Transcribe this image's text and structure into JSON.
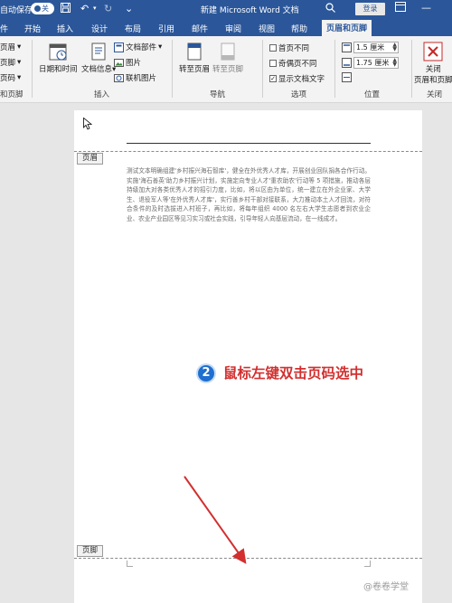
{
  "titlebar": {
    "autosave_label": "自动保存",
    "autosave_state": "关",
    "doc_title": "新建 Microsoft Word 文档",
    "login_label": "登录"
  },
  "tabs": [
    "件",
    "开始",
    "插入",
    "设计",
    "布局",
    "引用",
    "邮件",
    "审阅",
    "视图",
    "帮助",
    "页眉和页脚"
  ],
  "active_tab": "页眉和页脚",
  "ribbon": {
    "left_items": [
      "页眉",
      "页脚",
      "页码"
    ],
    "left_group": "和页脚",
    "date_time": "日期和时间",
    "doc_info": "文档信息",
    "doc_parts": "文档部件",
    "picture": "图片",
    "online_picture": "联机图片",
    "insert_group": "插入",
    "goto_header": "转至页眉",
    "goto_footer": "转至页脚",
    "nav_group": "导航",
    "first_page_diff": "首页不同",
    "odd_even_diff": "奇偶页不同",
    "show_doc_text": "显示文档文字",
    "options_group": "选项",
    "header_pos": "1.5 厘米",
    "footer_pos": "1.75 厘米",
    "position_group": "位置",
    "close_label": "关闭",
    "close_label2": "页眉和页脚",
    "close_group": "关闭"
  },
  "document": {
    "header_tag": "页眉",
    "footer_tag": "页脚",
    "body_text": "测试文本明确组建'乡村振兴海石智库'，健全在外优秀人才库，开展创业回队捐各合作行动。实施'海石善英'助力乡村振兴计划，实施定向专业人才'重农助农'行动等 5 项措施，推动各层持级加大对各类优秀人才的招引力度，比如，将以区由为单位，统一建立在外企业家、大学生、退役军人等'在外优秀人才库'，实行善乡村干部对接联系，大力推动本土人才回流，对符合条件的及时选拔进入村班子，再比如，将每年组织 4000 名左右大学生志愿者到农业企业、农业产业园区等见习实习或社会实践，引导年轻人向基层流动，在一线成才。"
  },
  "annotation": {
    "step": "2",
    "text": "鼠标左键双击页码选中"
  },
  "watermark": "@卷卷学堂",
  "colors": {
    "word_blue": "#2b579a",
    "annotation_red": "#d32f2f",
    "badge_blue": "#1e6fd0"
  }
}
